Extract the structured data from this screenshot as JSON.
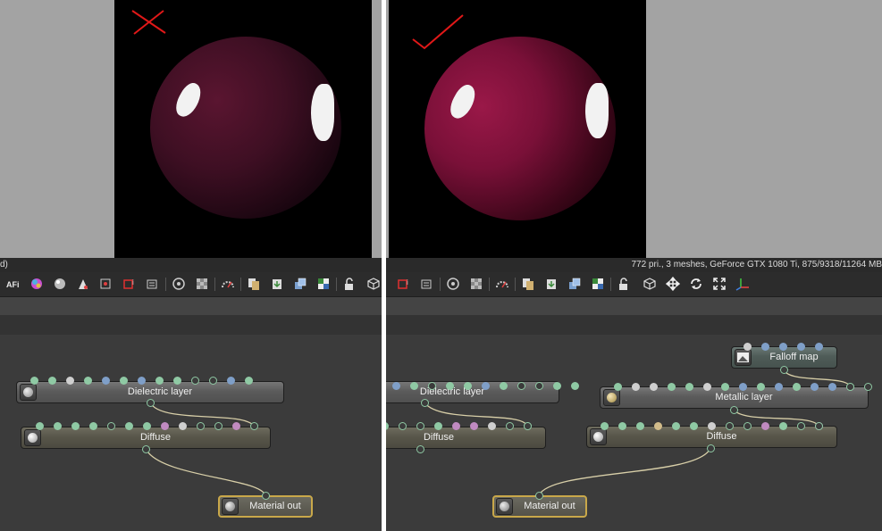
{
  "left_panel": {
    "status_text": "d)",
    "result_mark": "cross-mark-icon",
    "nodes": {
      "dielectric": "Dielectric layer",
      "diffuse": "Diffuse",
      "material_out": "Material out"
    }
  },
  "right_panel": {
    "status_text": "772 pri., 3 meshes, GeForce GTX 1080 Ti, 875/9318/11264 MB",
    "result_mark": "check-mark-icon",
    "nodes": {
      "dielectric": "Dielectric layer",
      "diffuse_partial": "Diffuse",
      "falloff": "Falloff map",
      "metallic": "Metallic layer",
      "diffuse": "Diffuse",
      "material_out": "Material out"
    }
  },
  "toolbar_icons_left": [
    "afi-icon",
    "color-wheel-icon",
    "sphere-sample-icon",
    "paint-icon",
    "render-pass-icon",
    "region-icon",
    "film-region-icon",
    "camera-settings-icon",
    "texture-icon",
    "exposure-icon",
    "copy-icon",
    "paste-icon",
    "layers-icon",
    "checker-icon",
    "lock-icon",
    "cube-icon"
  ],
  "toolbar_icons_right": [
    "region-icon",
    "film-region-icon",
    "camera-settings-icon",
    "texture-icon",
    "exposure-icon",
    "copy-icon",
    "paste-icon",
    "layers-icon",
    "checker-icon",
    "lock-icon",
    "cube-icon",
    "move-icon",
    "rotate-icon",
    "fit-icon",
    "axes-icon"
  ],
  "colors": {
    "sphere": "#8a1440",
    "wire": "#d8cfa8",
    "output_border": "#c9a84a",
    "port_green": "#8fc9a4",
    "port_blue": "#7f9fc8",
    "port_pink": "#c08ac0",
    "port_tan": "#d2bc8a",
    "port_gray": "#cfcfcf"
  }
}
